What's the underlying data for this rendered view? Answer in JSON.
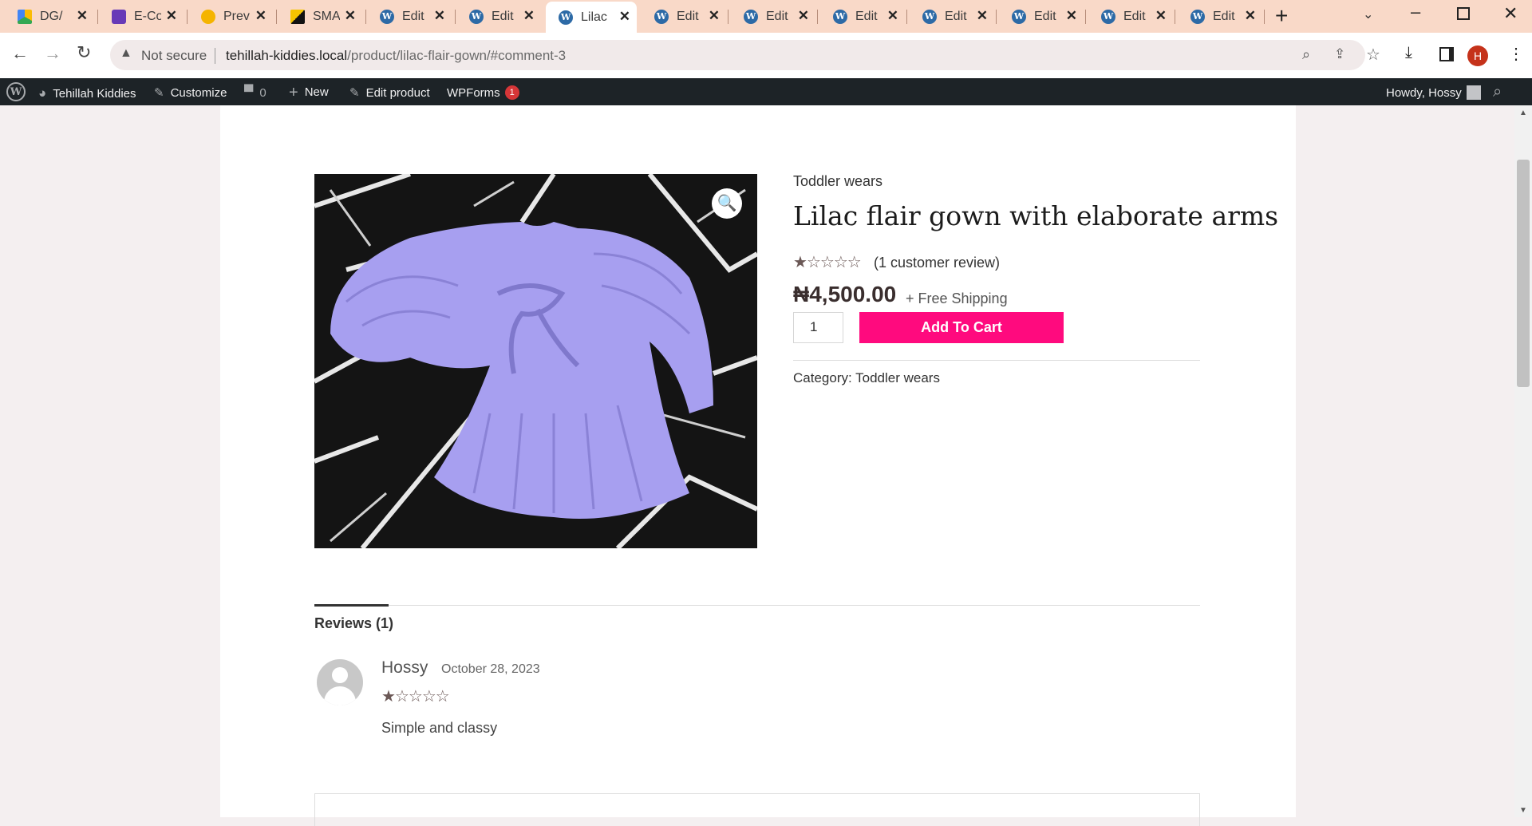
{
  "browser": {
    "tabs": [
      {
        "title": "DG/",
        "icon": "google-drive-icon"
      },
      {
        "title": "E-Co",
        "icon": "forms-icon"
      },
      {
        "title": "Prev",
        "icon": "preview-icon"
      },
      {
        "title": "SMA",
        "icon": "sma-icon"
      },
      {
        "title": "Edit",
        "icon": "wordpress-icon"
      },
      {
        "title": "Edit",
        "icon": "wordpress-icon"
      },
      {
        "title": "Lilac",
        "icon": "wordpress-icon"
      },
      {
        "title": "Edit",
        "icon": "wordpress-icon"
      },
      {
        "title": "Edit",
        "icon": "wordpress-icon"
      },
      {
        "title": "Edit",
        "icon": "wordpress-icon"
      },
      {
        "title": "Edit",
        "icon": "wordpress-icon"
      },
      {
        "title": "Edit",
        "icon": "wordpress-icon"
      },
      {
        "title": "Edit",
        "icon": "wordpress-icon"
      },
      {
        "title": "Edit",
        "icon": "wordpress-icon"
      }
    ],
    "security_label": "Not secure",
    "url_host": "tehillah-kiddies.local",
    "url_path": "/product/lilac-flair-gown/#comment-3",
    "profile_initial": "H"
  },
  "adminbar": {
    "site_name": "Tehillah Kiddies",
    "customize": "Customize",
    "comments_count": "0",
    "new": "New",
    "edit_product": "Edit product",
    "wpforms": "WPForms",
    "wpforms_badge": "1",
    "howdy": "Howdy, Hossy"
  },
  "product": {
    "category_top": "Toddler wears",
    "title": "Lilac flair gown with elaborate arms",
    "rating_stars": 1,
    "reviews_link": "(1 customer review)",
    "price": "₦4,500.00",
    "shipping": "+ Free Shipping",
    "quantity": "1",
    "add_to_cart": "Add To Cart",
    "category_label": "Category:",
    "category_value": "Toddler wears"
  },
  "tabs": {
    "reviews_label": "Reviews (1)"
  },
  "review": {
    "author": "Hossy",
    "date": "October 28, 2023",
    "rating_stars": 1,
    "text": "Simple and classy"
  },
  "colors": {
    "accent": "#ff0a7e",
    "tabbar": "#f9d9c8",
    "adminbar": "#1d2327",
    "dress": "#a79ff0"
  }
}
